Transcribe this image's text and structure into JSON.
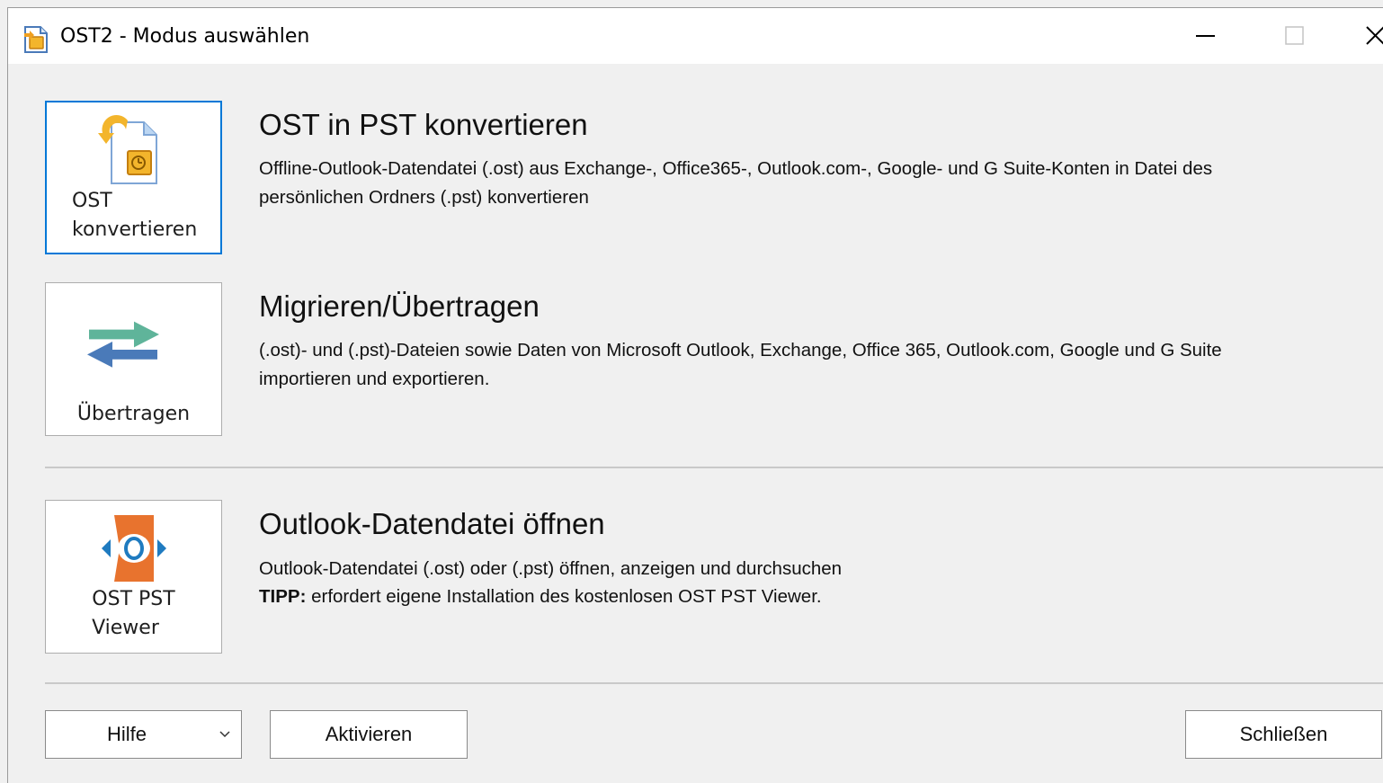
{
  "window": {
    "title": "OST2 - Modus auswählen",
    "controls": [
      "minimize-icon",
      "maximize-icon",
      "close-icon"
    ]
  },
  "modes": [
    {
      "button_line1": "OST",
      "button_line2": "konvertieren",
      "heading": "OST in PST konvertieren",
      "desc_line1": "Offline-Outlook-Datendatei (.ost) aus Exchange-, Office365-, Outlook.com-, Google- und G Suite-Konten in Datei des",
      "desc_line2": "persönlichen Ordners (.pst) konvertieren",
      "selected": true
    },
    {
      "button_label": "Übertragen",
      "heading": "Migrieren/Übertragen",
      "desc_line1": "(.ost)- und (.pst)-Dateien sowie Daten von Microsoft Outlook, Exchange, Office 365, Outlook.com, Google und G Suite",
      "desc_line2": "importieren und exportieren.",
      "selected": false
    },
    {
      "button_line1": "OST PST",
      "button_line2": "Viewer",
      "heading": "Outlook-Datendatei öffnen",
      "desc_line1": "Outlook-Datendatei (.ost) oder (.pst) öffnen, anzeigen und durchsuchen",
      "tip_label": "TIPP:",
      "tip_text": " erfordert eigene Installation des kostenlosen OST PST Viewer.",
      "selected": false
    }
  ],
  "footer": {
    "help_label": "Hilfe",
    "activate_label": "Aktivieren",
    "close_label": "Schließen"
  },
  "colors": {
    "selection_border": "#0078d7",
    "background": "#f0f0f0",
    "arrow_green": "#5fb49a",
    "arrow_blue": "#4a7ab9",
    "viewer_orange": "#e8732e",
    "viewer_blue": "#1f7bc0"
  }
}
